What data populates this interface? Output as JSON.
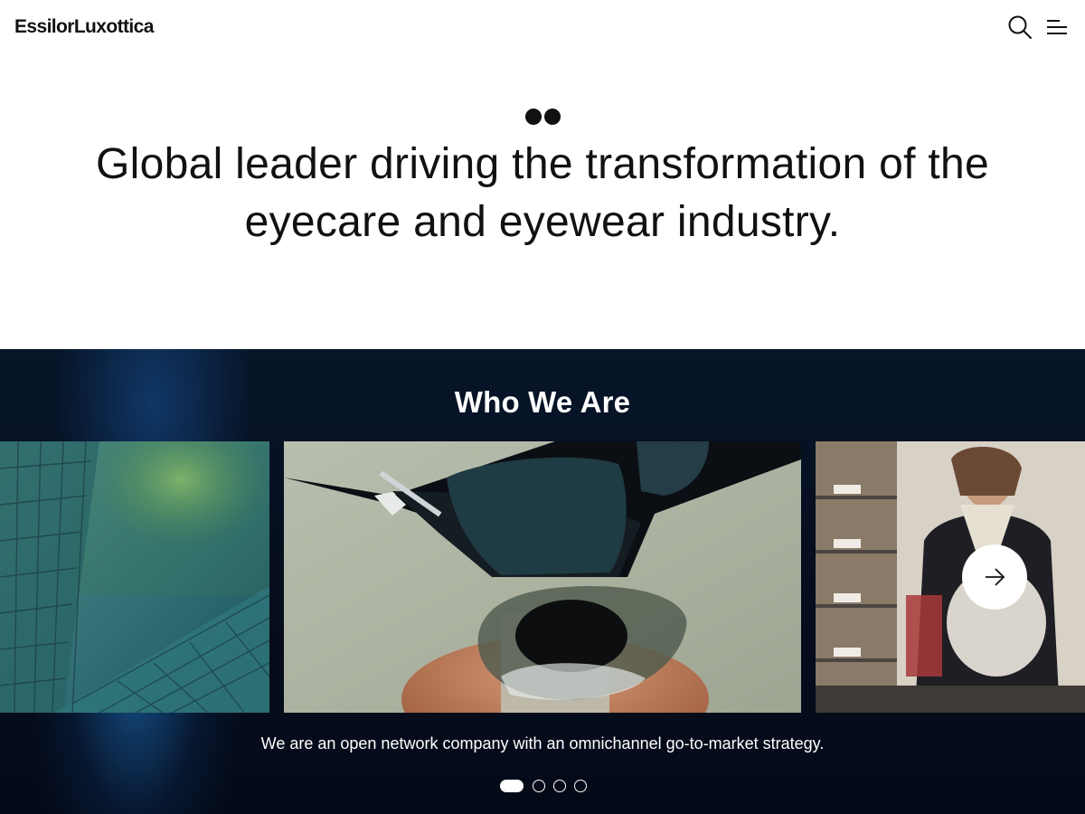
{
  "header": {
    "logo": "EssilorLuxottica",
    "search_icon": "search-icon",
    "menu_icon": "menu-icon"
  },
  "hero": {
    "headline": "Global leader driving the transformation of the eyecare and eyewear industry."
  },
  "who_we_are": {
    "title": "Who We Are",
    "caption": "We are an open network company with an omnichannel go-to-market strategy.",
    "slides": [
      {
        "image": "glass-building-with-trees"
      },
      {
        "image": "sunglasses-and-lens-on-stand"
      },
      {
        "image": "optician-fitting-glasses-in-store"
      }
    ],
    "next_icon": "arrow-right-icon",
    "pagination": {
      "total": 4,
      "active": 1
    }
  },
  "colors": {
    "text": "#111111",
    "section_bg": "#060d1d",
    "accent_blue": "#185a96",
    "white": "#ffffff"
  }
}
